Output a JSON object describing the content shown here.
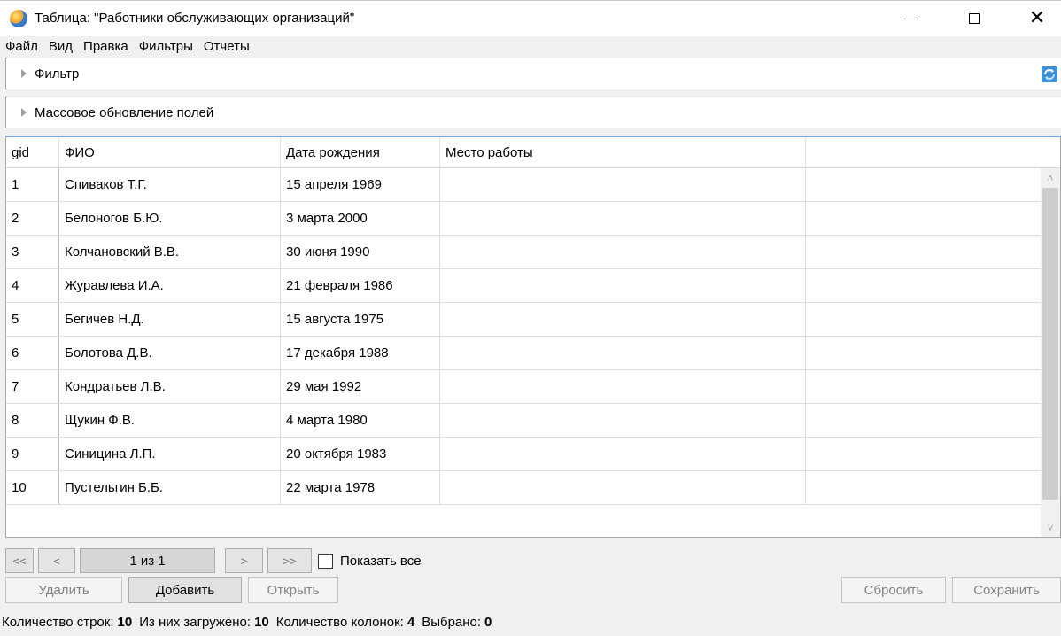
{
  "window": {
    "title": "Таблица: \"Работники обслуживающих организаций\"",
    "controls": {
      "minimize": "minimize-icon",
      "maximize": "maximize-icon",
      "close": "✕"
    }
  },
  "menu": [
    "Файл",
    "Вид",
    "Правка",
    "Фильтры",
    "Отчеты"
  ],
  "panels": {
    "filter_label": "Фильтр",
    "mass_update_label": "Массовое обновление полей"
  },
  "grid": {
    "columns": [
      "gid",
      "ФИО",
      "Дата рождения",
      "Место работы",
      ""
    ],
    "rows": [
      [
        "1",
        "Спиваков Т.Г.",
        "15 апреля 1969",
        "",
        ""
      ],
      [
        "2",
        "Белоногов Б.Ю.",
        "3 марта 2000",
        "",
        ""
      ],
      [
        "3",
        "Колчановский В.В.",
        "30 июня 1990",
        "",
        ""
      ],
      [
        "4",
        "Журавлева И.А.",
        "21 февраля 1986",
        "",
        ""
      ],
      [
        "5",
        "Бегичев Н.Д.",
        "15 августа 1975",
        "",
        ""
      ],
      [
        "6",
        "Болотова Д.В.",
        "17 декабря 1988",
        "",
        ""
      ],
      [
        "7",
        "Кондратьев Л.В.",
        "29 мая 1992",
        "",
        ""
      ],
      [
        "8",
        "Щукин Ф.В.",
        "4 марта 1980",
        "",
        ""
      ],
      [
        "9",
        "Синицина Л.П.",
        "20 октября 1983",
        "",
        ""
      ],
      [
        "10",
        "Пустельгин Б.Б.",
        "22 марта 1978",
        "",
        ""
      ]
    ]
  },
  "pager": {
    "first": "<<",
    "prev": "<",
    "page_info": "1 из 1",
    "next": ">",
    "last": ">>",
    "show_all_label": "Показать все",
    "show_all_checked": false
  },
  "buttons": {
    "delete": "Удалить",
    "add": "Добавить",
    "open": "Открыть",
    "reset": "Сбросить",
    "save": "Сохранить"
  },
  "status": {
    "rows_label": "Количество строк:",
    "rows_value": "10",
    "loaded_label": "Из них загружено:",
    "loaded_value": "10",
    "columns_label": "Количество колонок:",
    "columns_value": "4",
    "selected_label": "Выбрано:",
    "selected_value": "0"
  },
  "colors": {
    "accent_border": "#7aa7d8",
    "window_bg": "#f0f0f0"
  }
}
